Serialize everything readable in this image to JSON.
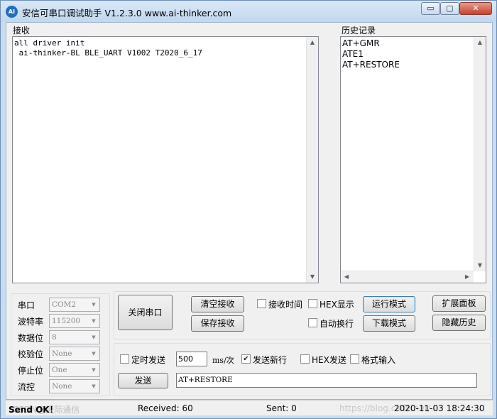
{
  "window": {
    "title": "安信可串口调试助手 V1.2.3.0    www.ai-thinker.com",
    "icon_text": "AI",
    "min_glyph": "▭",
    "max_glyph": "▢",
    "close_glyph": "✕"
  },
  "receive": {
    "label": "接收",
    "lines": "all driver init\n ai-thinker-BL BLE_UART V1002 T2020_6_17"
  },
  "history": {
    "label": "历史记录",
    "items": [
      "AT+GMR",
      "ATE1",
      "AT+RESTORE"
    ]
  },
  "serial": {
    "port_label": "串口",
    "port_value": "COM2",
    "baud_label": "波特率",
    "baud_value": "115200",
    "data_label": "数据位",
    "data_value": "8",
    "parity_label": "校验位",
    "parity_value": "None",
    "stop_label": "停止位",
    "stop_value": "One",
    "flow_label": "流控",
    "flow_value": "None"
  },
  "controls": {
    "close_port": "关闭串口",
    "clear_recv": "清空接收",
    "save_recv": "保存接收",
    "recv_time": "接收时间",
    "hex_show": "HEX显示",
    "auto_newline": "自动换行",
    "run_mode": "运行模式",
    "download_mode": "下载模式",
    "expand_panel": "扩展面板",
    "hide_history": "隐藏历史"
  },
  "send": {
    "timed_send": "定时发送",
    "interval": "500",
    "interval_unit": "ms/次",
    "send_newline": "发送新行",
    "hex_send": "HEX发送",
    "format_input": "格式输入",
    "send_button": "发送",
    "send_text": "AT+RESTORE",
    "send_newline_checked": "✔"
  },
  "status": {
    "left": "Send OK！",
    "received": "Received: 60",
    "sent": "Sent: 0",
    "datetime": "2020-11-03 18:24:30",
    "watermark": "https://blog.csdn.net/...",
    "watermark_left": "CSDN@天际通信"
  }
}
